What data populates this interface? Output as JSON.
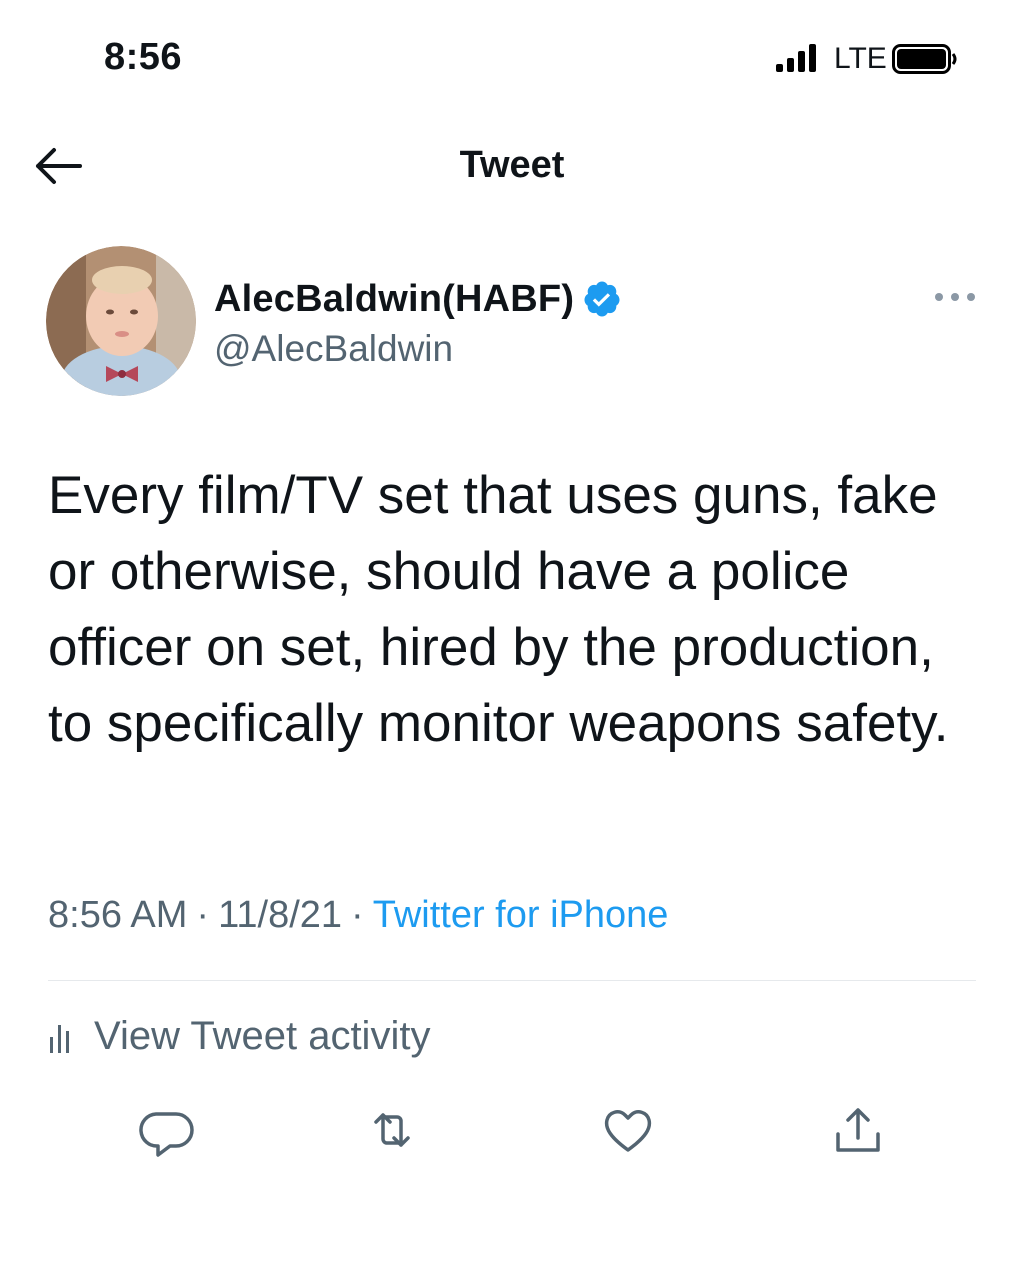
{
  "status_bar": {
    "time": "8:56",
    "network": "LTE"
  },
  "header": {
    "title": "Tweet"
  },
  "tweet": {
    "author": {
      "display_name": "AlecBaldwin(HABF)",
      "handle": "@AlecBaldwin",
      "verified": true
    },
    "text": "Every film/TV set that uses guns, fake or otherwise, should have a police officer on set, hired by the production, to specifically monitor weapons safety.",
    "time": "8:56 AM",
    "date": "11/8/21",
    "source": "Twitter for iPhone",
    "separator": "·",
    "activity_label": "View Tweet activity"
  },
  "colors": {
    "accent": "#1d9bf0",
    "secondary_text": "#536471",
    "primary_text": "#0f1419",
    "divider": "#e6e9ec"
  },
  "icons": {
    "back": "arrow-left-icon",
    "verified": "verified-badge-icon",
    "more": "more-dots-icon",
    "activity": "bar-chart-icon",
    "reply": "reply-icon",
    "retweet": "retweet-icon",
    "like": "heart-icon",
    "share": "share-icon"
  }
}
